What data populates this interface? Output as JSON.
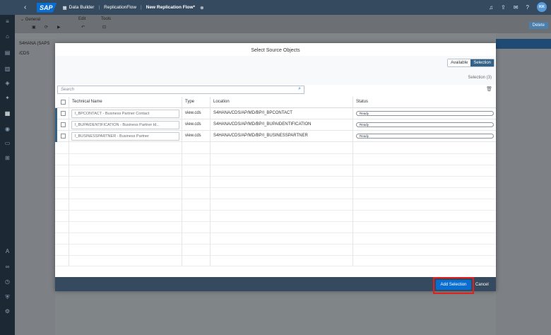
{
  "shell": {
    "logo": "SAP",
    "crumb_1": "Data Builder",
    "crumb_2": "ReplicationFlow",
    "crumb_3": "New Replication Flow*",
    "avatar": "KK"
  },
  "toolbar": {
    "general": "General",
    "edit": "Edit",
    "tools": "Tools"
  },
  "background": {
    "left_item_1": "S4HANA (SAPS",
    "left_item_2": "/CDS",
    "delete_label": "Delete"
  },
  "modal": {
    "title": "Select Source Objects",
    "tab_available": "Available",
    "tab_selection": "Selection",
    "selection_count": "Selection (3)",
    "search_placeholder": "Search",
    "columns": {
      "name": "Technical Name",
      "type": "Type",
      "location": "Location",
      "status": "Status"
    },
    "rows": [
      {
        "name": "I_BPCONTACT - Business Partner Contact",
        "type": "view.cds",
        "location": "S4HANA/CDS/AP/MD/BP/I_BPCONTACT",
        "status": "Ready"
      },
      {
        "name": "I_BUPAIDENTIFICATION - Business Partner Id...",
        "type": "view.cds",
        "location": "S4HANA/CDS/AP/MD/BP/I_BUPAIDENTIFICATION",
        "status": "Ready"
      },
      {
        "name": "I_BUSINESSPARTNER - Business Partner",
        "type": "view.cds",
        "location": "S4HANA/CDS/AP/MD/BP/I_BUSINESSPARTNER",
        "status": "Ready"
      }
    ],
    "add_label": "Add Selection",
    "cancel_label": "Cancel"
  },
  "colors": {
    "shell": "#354a5f",
    "accent": "#0a6ed1",
    "highlight": "#e02020"
  }
}
